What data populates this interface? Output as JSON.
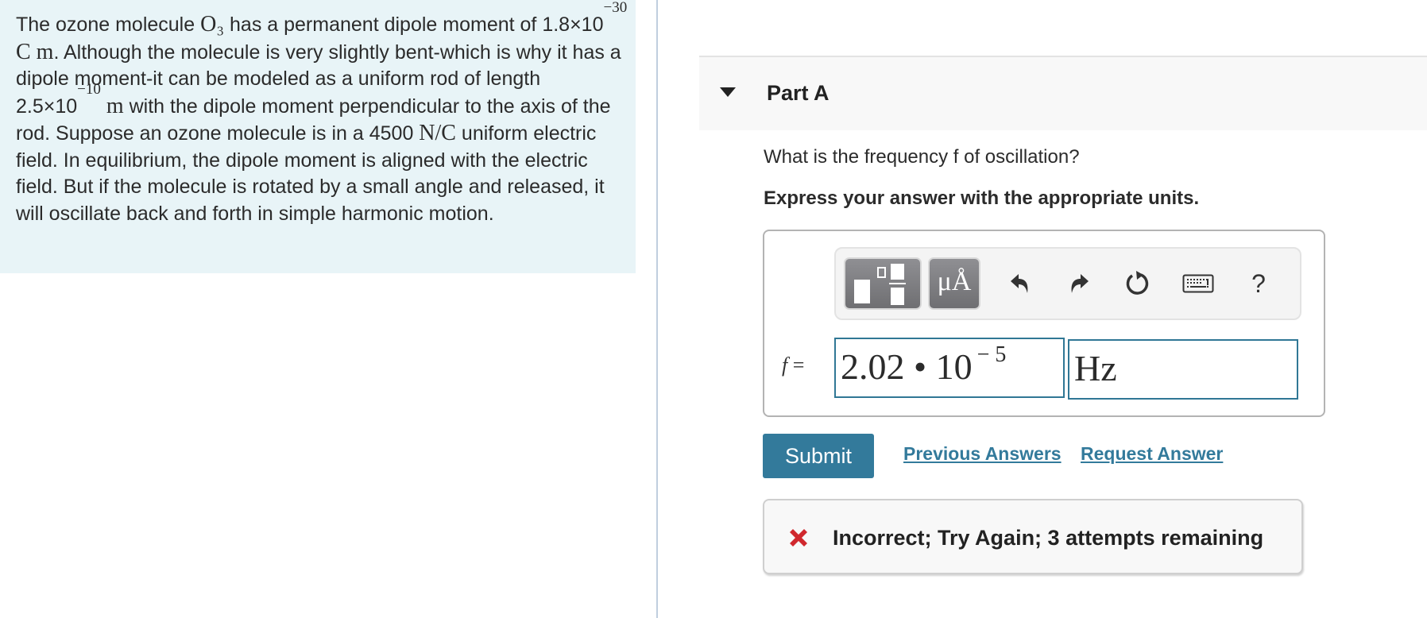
{
  "problem": {
    "segments": [
      {
        "type": "text",
        "value": "The ozone molecule "
      },
      {
        "type": "math",
        "value": "O₃"
      },
      {
        "type": "text",
        "value": " has a permanent dipole moment of "
      },
      {
        "type": "text",
        "value": "1.8×10"
      },
      {
        "type": "sup",
        "value": "−30"
      },
      {
        "type": "math",
        "value": " C m"
      },
      {
        "type": "text",
        "value": ". Although the molecule is very slightly bent-which is why it has a dipole moment-it can be modeled as a uniform rod of length 2.5×10"
      },
      {
        "type": "sup",
        "value": "−10"
      },
      {
        "type": "math",
        "value": " m"
      },
      {
        "type": "text",
        "value": " with the dipole moment perpendicular to the axis of the rod. Suppose an ozone molecule is in a 4500 "
      },
      {
        "type": "math",
        "value": "N/C"
      },
      {
        "type": "text",
        "value": " uniform electric field. In equilibrium, the dipole moment is aligned with the electric field. But if the molecule is rotated by a small angle and released, it will oscillate back and forth in simple harmonic motion."
      }
    ]
  },
  "part": {
    "title": "Part A",
    "question": "What is the frequency f of oscillation?",
    "instruction": "Express your answer with the appropriate units."
  },
  "toolbar": {
    "templates_icon": "templates-icon",
    "units_label": "μÅ",
    "undo_icon": "undo-icon",
    "redo_icon": "redo-icon",
    "reset_icon": "reset-icon",
    "keyboard_icon": "keyboard-icon",
    "help_label": "?"
  },
  "answer": {
    "variable": "f",
    "equals": "=",
    "value_mantissa": "2.02 • 10",
    "value_exponent": "− 5",
    "unit": "Hz"
  },
  "actions": {
    "submit_label": "Submit",
    "previous_answers_label": "Previous Answers",
    "request_answer_label": "Request Answer"
  },
  "feedback": {
    "status": "incorrect",
    "message": "Incorrect; Try Again; 3 attempts remaining",
    "icon_color": "#d0282e"
  },
  "colors": {
    "accent": "#337a9b",
    "problem_background": "#e8f4f7",
    "input_border": "#307795"
  }
}
